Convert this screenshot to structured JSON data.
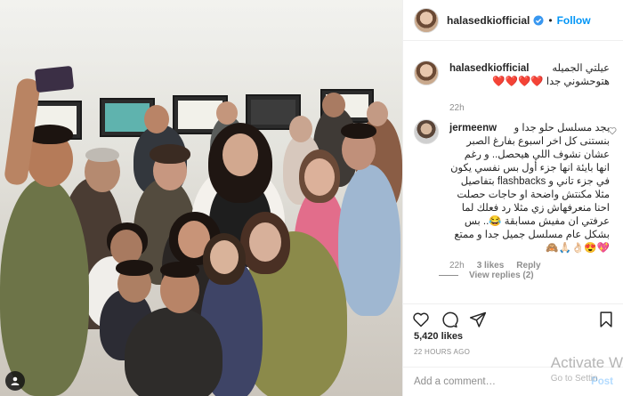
{
  "post": {
    "username": "halasedkiofficial",
    "follow_label": "Follow",
    "dot": "•"
  },
  "caption": {
    "username": "halasedkiofficial",
    "line1": "عيلتي الجميله",
    "line2": "هتوحشوني جدا ❤️❤️❤️❤️",
    "time": "22h"
  },
  "comment": {
    "username": "jermeenw",
    "text_lines": [
      "بجد مسلسل حلو جدا و",
      "بنستنى كل اخر اسبوع بفارغ الصبر",
      "عشان نشوف اللي هيحصل.. و رغم",
      "انها بايئة انها جزء أول بس نفسي يكون",
      "في جزء تاني و flashbacks بتفاصيل",
      "مثلا مكنتش واضحة او حاجات حصلت",
      "احنا منعرفهاش زي مثلا رد فعلك لما",
      "عرفتي ان مفيش مسابقة 😂.. بس",
      "بشكل عام مسلسل جميل جدا و ممتع",
      "💖😍👌🏻🙏🏻🙈"
    ],
    "time": "22h",
    "likes": "3 likes",
    "reply_label": "Reply",
    "view_replies": "View replies (2)"
  },
  "actions": {
    "likes": "5,420 likes",
    "timestamp": "22 HOURS AGO"
  },
  "add_comment": {
    "placeholder": "Add a comment…",
    "post_label": "Post"
  },
  "watermark": {
    "line1": "Activate W",
    "line2": "Go to Settin"
  },
  "colors": {
    "accent": "#0095f6",
    "heart": "#ed4956"
  }
}
